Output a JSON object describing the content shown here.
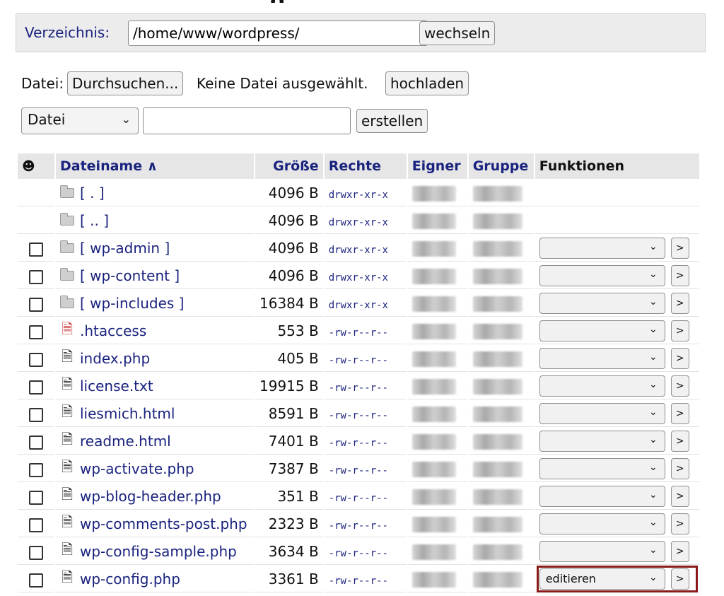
{
  "page": {
    "heading_partial": "g"
  },
  "directory": {
    "label": "Verzeichnis:",
    "value": "/home/www/wordpress/",
    "change_button": "wechseln"
  },
  "upload": {
    "label": "Datei:",
    "browse_button": "Durchsuchen...",
    "status": "Keine Datei ausgewählt.",
    "upload_button": "hochladen"
  },
  "create": {
    "type_selected": "Datei",
    "name_value": "",
    "create_button": "erstellen"
  },
  "table": {
    "headers": {
      "icon": "☻",
      "name": "Dateiname ∧",
      "size": "Größe",
      "rights": "Rechte",
      "owner": "Eigner",
      "group": "Gruppe",
      "functions": "Funktionen"
    },
    "rows": [
      {
        "name": "[ . ]",
        "size": "4096 B",
        "rights": "drwxr-xr-x",
        "type": "folder",
        "checkbox": false,
        "functions": false
      },
      {
        "name": "[ .. ]",
        "size": "4096 B",
        "rights": "drwxr-xr-x",
        "type": "folder",
        "checkbox": false,
        "functions": false
      },
      {
        "name": "[ wp-admin ]",
        "size": "4096 B",
        "rights": "drwxr-xr-x",
        "type": "folder",
        "checkbox": true,
        "functions": true
      },
      {
        "name": "[ wp-content ]",
        "size": "4096 B",
        "rights": "drwxr-xr-x",
        "type": "folder",
        "checkbox": true,
        "functions": true
      },
      {
        "name": "[ wp-includes ]",
        "size": "16384 B",
        "rights": "drwxr-xr-x",
        "type": "folder",
        "checkbox": true,
        "functions": true
      },
      {
        "name": ".htaccess",
        "size": "553 B",
        "rights": "-rw-r--r--",
        "type": "special",
        "checkbox": true,
        "functions": true
      },
      {
        "name": "index.php",
        "size": "405 B",
        "rights": "-rw-r--r--",
        "type": "file",
        "checkbox": true,
        "functions": true
      },
      {
        "name": "license.txt",
        "size": "19915 B",
        "rights": "-rw-r--r--",
        "type": "file",
        "checkbox": true,
        "functions": true
      },
      {
        "name": "liesmich.html",
        "size": "8591 B",
        "rights": "-rw-r--r--",
        "type": "file",
        "checkbox": true,
        "functions": true
      },
      {
        "name": "readme.html",
        "size": "7401 B",
        "rights": "-rw-r--r--",
        "type": "file",
        "checkbox": true,
        "functions": true
      },
      {
        "name": "wp-activate.php",
        "size": "7387 B",
        "rights": "-rw-r--r--",
        "type": "file",
        "checkbox": true,
        "functions": true
      },
      {
        "name": "wp-blog-header.php",
        "size": "351 B",
        "rights": "-rw-r--r--",
        "type": "file",
        "checkbox": true,
        "functions": true
      },
      {
        "name": "wp-comments-post.php",
        "size": "2323 B",
        "rights": "-rw-r--r--",
        "type": "file",
        "checkbox": true,
        "functions": true
      },
      {
        "name": "wp-config-sample.php",
        "size": "3634 B",
        "rights": "-rw-r--r--",
        "type": "file",
        "checkbox": true,
        "functions": true
      },
      {
        "name": "wp-config.php",
        "size": "3361 B",
        "rights": "-rw-r--r--",
        "type": "file",
        "checkbox": true,
        "functions": true,
        "selected_function": "editieren",
        "highlighted": true
      }
    ],
    "go_label": ">"
  },
  "colors": {
    "link": "#1a237e",
    "highlight": "#8b1a1a",
    "special_file_icon": "#c62828"
  }
}
